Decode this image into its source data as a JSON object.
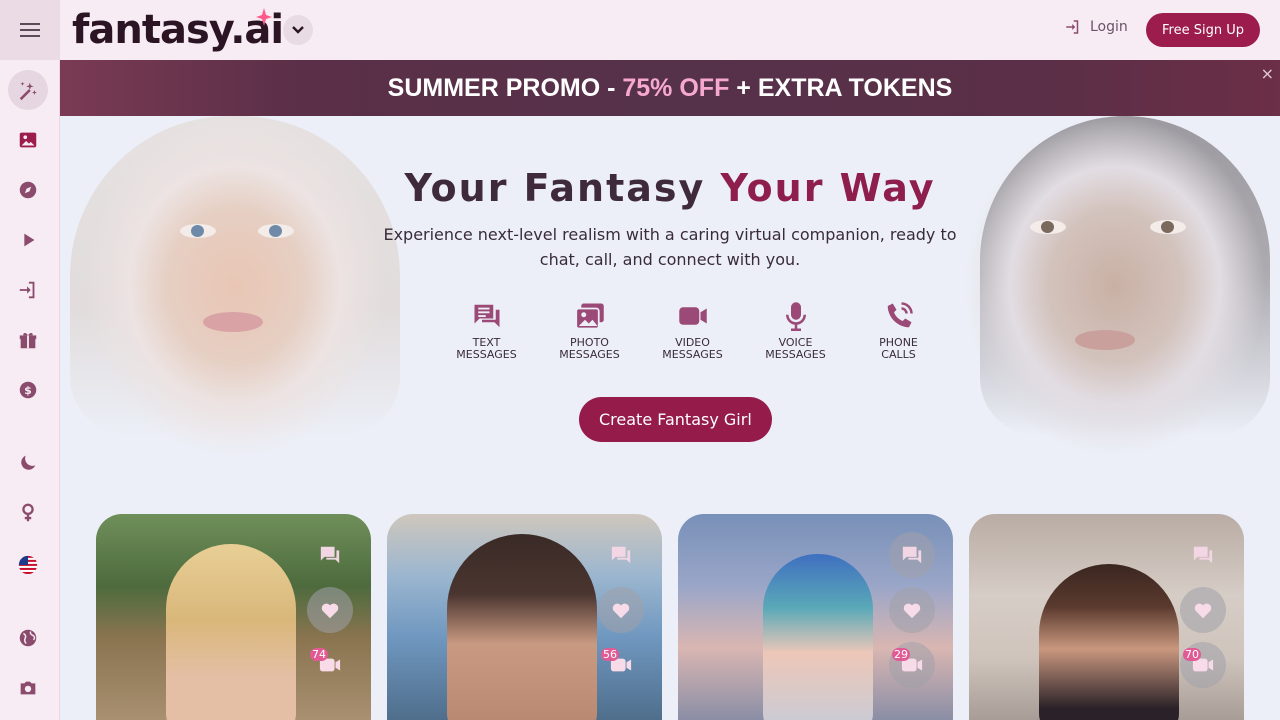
{
  "header": {
    "logo_text": "fantasy.ai",
    "login_label": "Login",
    "signup_label": "Free Sign Up"
  },
  "sidebar": {
    "items": [
      {
        "icon": "magic-icon"
      },
      {
        "icon": "gallery-icon"
      },
      {
        "icon": "compass-icon"
      },
      {
        "icon": "play-icon"
      },
      {
        "icon": "login-icon"
      },
      {
        "icon": "gift-icon"
      },
      {
        "icon": "dollar-icon"
      },
      {
        "icon": "moon-icon"
      },
      {
        "icon": "female-icon"
      },
      {
        "icon": "us-flag-icon"
      },
      {
        "icon": "globe-icon"
      },
      {
        "icon": "camera-icon"
      }
    ]
  },
  "promo": {
    "prefix": "SUMMER PROMO - ",
    "highlight": "75% OFF",
    "suffix": " + EXTRA TOKENS",
    "close": "×"
  },
  "hero": {
    "title_part1": "Your Fantasy ",
    "title_part2": "Your Way",
    "subtitle": "Experience next-level realism with a caring virtual companion, ready to chat, call, and connect with you.",
    "features": [
      {
        "line1": "TEXT",
        "line2": "MESSAGES",
        "icon": "text-messages-icon"
      },
      {
        "line1": "PHOTO",
        "line2": "MESSAGES",
        "icon": "photo-messages-icon"
      },
      {
        "line1": "VIDEO",
        "line2": "MESSAGES",
        "icon": "video-messages-icon"
      },
      {
        "line1": "VOICE",
        "line2": "MESSAGES",
        "icon": "voice-messages-icon"
      },
      {
        "line1": "PHONE",
        "line2": "CALLS",
        "icon": "phone-calls-icon"
      }
    ],
    "cta_label": "Create Fantasy Girl"
  },
  "cards": [
    {
      "video_count": "74"
    },
    {
      "video_count": "56"
    },
    {
      "video_count": "29"
    },
    {
      "video_count": "70"
    }
  ],
  "colors": {
    "brand": "#951b4b",
    "accent_pink": "#f7a8cf",
    "icon": "#9b4a77"
  }
}
